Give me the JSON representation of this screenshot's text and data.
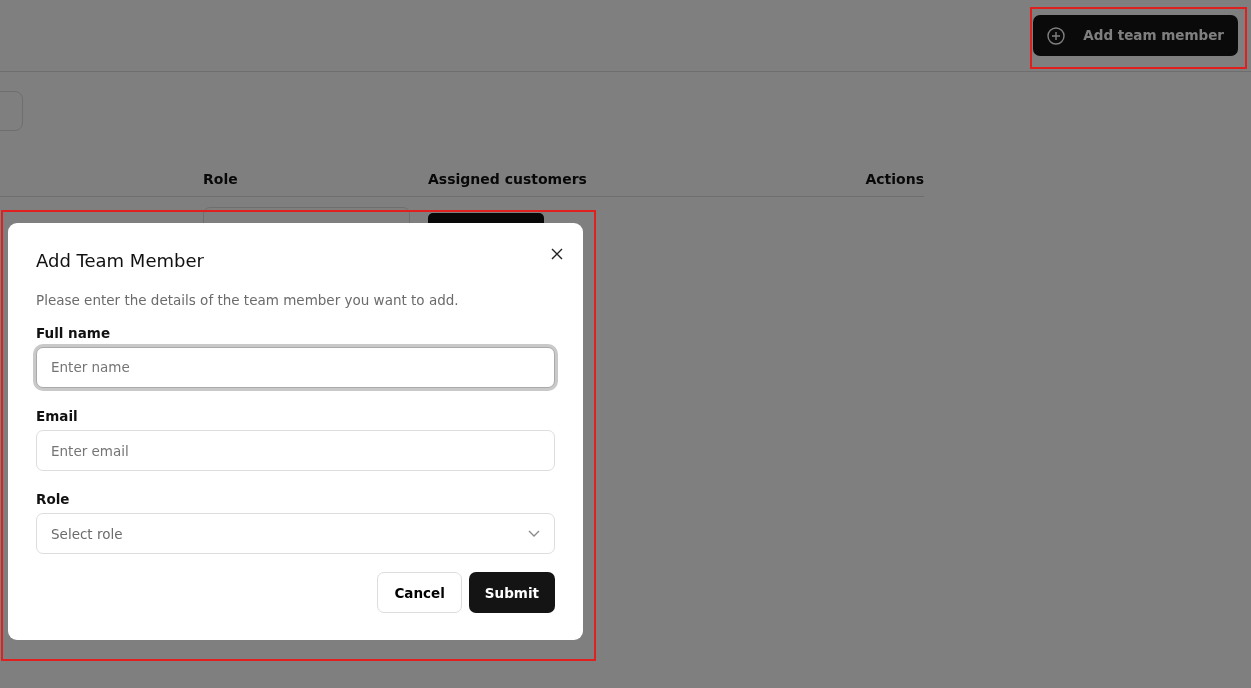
{
  "header": {
    "add_button": {
      "label": "Add team member"
    }
  },
  "table": {
    "columns": [
      {
        "label": "Role"
      },
      {
        "label": "Assigned customers"
      },
      {
        "label": "Actions"
      }
    ]
  },
  "dialog": {
    "title": "Add Team Member",
    "description": "Please enter the details of the team member you want to add.",
    "fields": [
      {
        "kind": "text",
        "label": "Full name",
        "placeholder": "Enter name",
        "focused": true
      },
      {
        "kind": "text",
        "label": "Email",
        "placeholder": "Enter email",
        "focused": false
      },
      {
        "kind": "select",
        "label": "Role",
        "placeholder": "Select role",
        "focused": false
      }
    ],
    "buttons": [
      {
        "label": "Cancel",
        "kind": "secondary"
      },
      {
        "label": "Submit",
        "kind": "primary"
      }
    ]
  }
}
